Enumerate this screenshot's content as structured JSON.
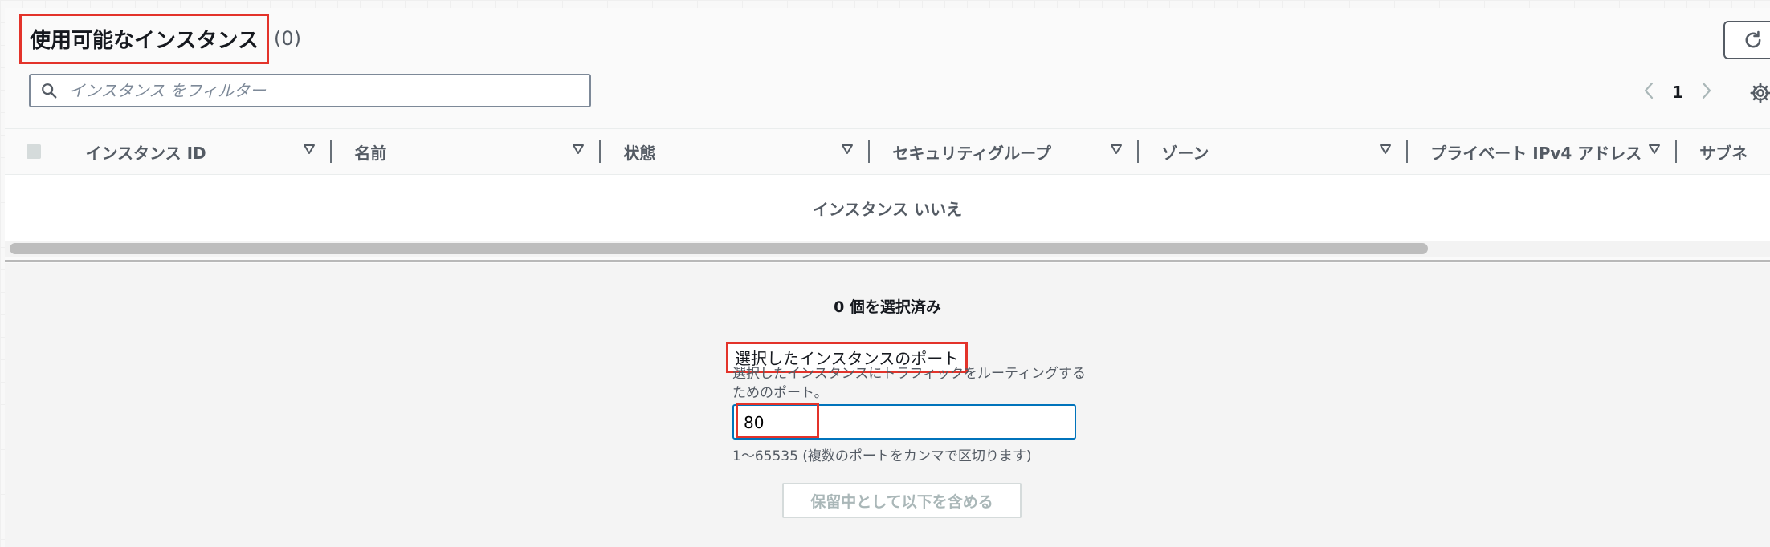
{
  "header": {
    "title": "使用可能なインスタンス",
    "count": "(0)"
  },
  "search": {
    "placeholder": "インスタンス をフィルター",
    "value": ""
  },
  "pagination": {
    "current_page": "1"
  },
  "table": {
    "columns": [
      "インスタンス ID",
      "名前",
      "状態",
      "セキュリティグループ",
      "ゾーン",
      "プライベート IPv4 アドレス",
      "サブネ"
    ],
    "empty_text": "インスタンス いいえ"
  },
  "selection": {
    "selected_text": "0 個を選択済み"
  },
  "port_field": {
    "label": "選択したインスタンスのポート",
    "description": "選択したインスタンスにトラフィックをルーティングするためのポート。",
    "value": "80",
    "hint": "1〜65535 (複数のポートをカンマで区切ります)"
  },
  "include_button": {
    "label": "保留中として以下を含める"
  },
  "colors": {
    "highlight": "#e3332a",
    "focus_border": "#0073bb",
    "disabled_text": "#aab7b8"
  },
  "icons": {
    "refresh": "refresh-icon",
    "search": "search-icon",
    "prev": "chevron-left-icon",
    "next": "chevron-right-icon",
    "settings": "gear-icon",
    "sort": "caret-down-icon"
  }
}
